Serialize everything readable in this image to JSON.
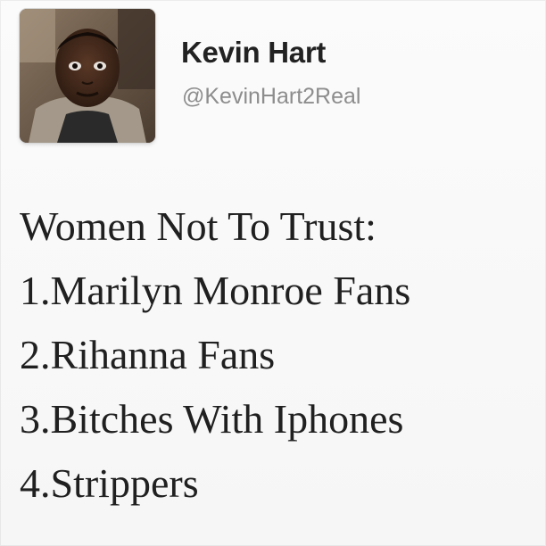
{
  "author": {
    "name": "Kevin Hart",
    "handle": "@KevinHart2Real",
    "avatar_icon": "profile-photo"
  },
  "tweet": {
    "lines": [
      "Women Not To Trust:",
      "1.Marilyn Monroe Fans",
      "2.Rihanna Fans",
      "3.Bitches With Iphones",
      "4.Strippers"
    ]
  },
  "colors": {
    "name": "#222222",
    "handle": "#8d8d8d",
    "text": "#202020",
    "background": "#f8f8f8"
  }
}
